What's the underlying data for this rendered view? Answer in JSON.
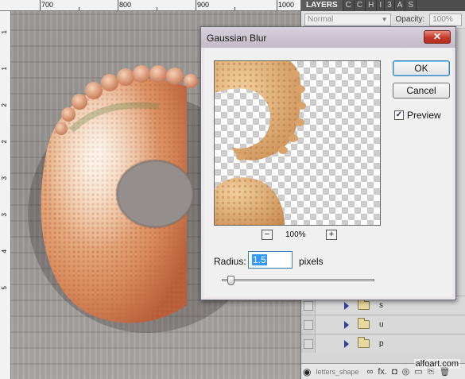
{
  "ruler": {
    "top_labels": [
      "700",
      "800",
      "900",
      "1000"
    ],
    "left_labels": [
      "1",
      "1",
      "2",
      "2",
      "3",
      "3",
      "4",
      "5"
    ]
  },
  "panel": {
    "tabs": [
      "LAYERS",
      "C",
      "C",
      "H",
      "I",
      "3",
      "A",
      "S"
    ],
    "blend_mode": "Normal",
    "opacity_label": "Opacity:",
    "opacity_value": "100%",
    "layers": [
      {
        "name": "s"
      },
      {
        "name": "u"
      },
      {
        "name": "p"
      }
    ],
    "bottom_layer_name": "letters_shape",
    "bottom_tools": [
      "∞",
      "fx.",
      "◘",
      "◎",
      "▭",
      "⎘",
      "🗑"
    ]
  },
  "watermark": "alfoart.com",
  "dialog": {
    "title": "Gaussian Blur",
    "close_label": "✕",
    "ok_label": "OK",
    "cancel_label": "Cancel",
    "preview_label": "Preview",
    "preview_checked": "✓",
    "zoom_out_label": "−",
    "zoom_in_label": "+",
    "zoom_level": "100%",
    "radius_label": "Radius:",
    "radius_value": "1.5",
    "radius_unit": "pixels",
    "radius_slider_position": 0.06
  },
  "colors": {
    "close_button": "#c4392a",
    "ok_button_border": "#3c7fb1",
    "selection": "#3399ff"
  }
}
